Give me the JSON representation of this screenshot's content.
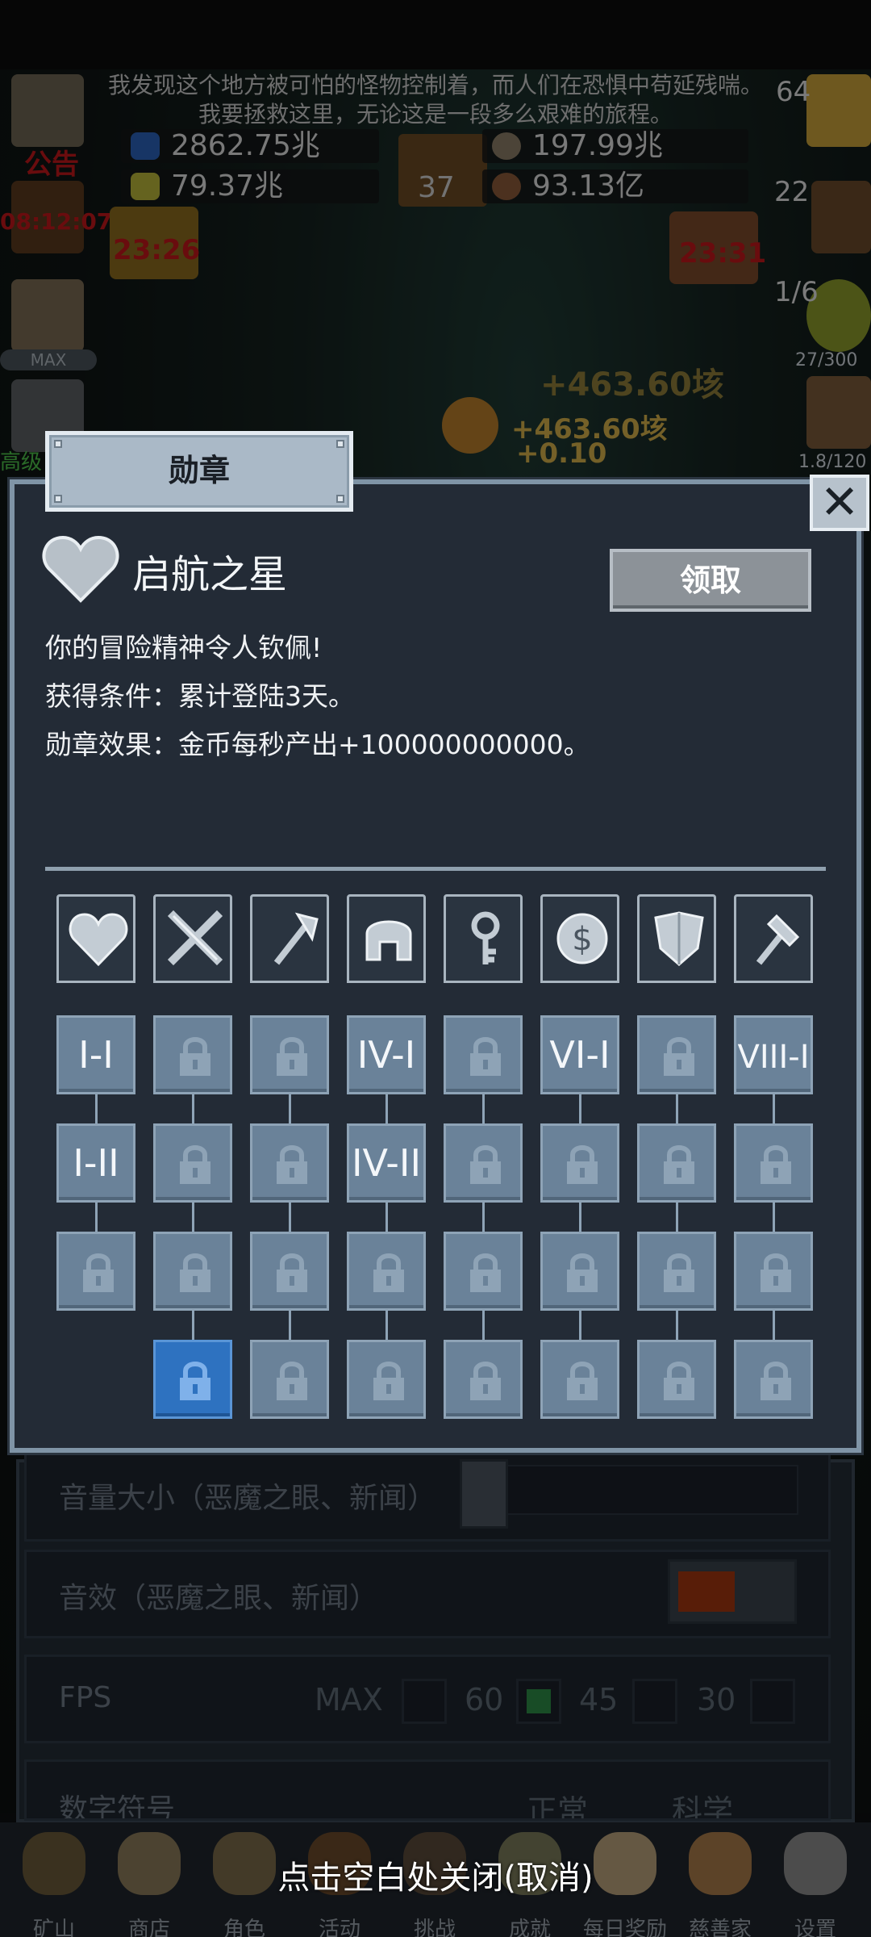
{
  "story": {
    "line1": "我发现这个地方被可怕的怪物控制着，而人们在恐惧中苟延残喘。",
    "line2": "我要拯救这里，无论这是一段多么艰难的旅程。"
  },
  "resources": {
    "blue_potion": "2862.75兆",
    "green_potion": "79.37兆",
    "book_level": "37",
    "stone": "197.99兆",
    "meat": "93.13亿"
  },
  "side": {
    "notice_label": "公告",
    "torch_timer": "08:12:07",
    "chest_timer": "23:26",
    "right_timer": "23:31",
    "potion_count": "64",
    "chest_count": "22",
    "slime_count": "1/6",
    "slime_hp": "27/300",
    "sword_ratio": "1.8/120",
    "max_label": "MAX",
    "key_label": "高级",
    "floating_gain_big": "+463.60垓",
    "floating_gain": "+463.60垓",
    "floating_small": "+0.10"
  },
  "settings": {
    "volume_label": "音量大小（恶魔之眼、新闻）",
    "sfx_label": "音效（恶魔之眼、新闻）",
    "fps_label": "FPS",
    "fps_options": [
      "MAX",
      "60",
      "45",
      "30"
    ],
    "fps_selected": "60",
    "number_label": "数字符号",
    "number_options": [
      "正常",
      "科学"
    ]
  },
  "nav": {
    "items": [
      "矿山",
      "商店",
      "角色",
      "活动",
      "挑战",
      "成就",
      "每日奖励",
      "慈善家",
      "设置"
    ],
    "close_hint": "点击空白处关闭(取消)"
  },
  "dialog": {
    "tab_title": "勋章",
    "close_glyph": "✕",
    "medal_name": "启航之星",
    "claim_label": "领取",
    "flavor": "你的冒险精神令人钦佩!",
    "condition": "获得条件：累计登陆3天。",
    "effect": "勋章效果：金币每秒产出+100000000000。",
    "categories": [
      "heart-icon",
      "crossed-swords-icon",
      "axe-icon",
      "helmet-icon",
      "key-icon",
      "coin-icon",
      "shield-icon",
      "hammer-icon"
    ],
    "grid": [
      [
        "I-I",
        "",
        "",
        "IV-I",
        "",
        "VI-I",
        "",
        "VIII-I"
      ],
      [
        "I-II",
        "",
        "",
        "IV-II",
        "",
        "",
        "",
        ""
      ],
      [
        "",
        "",
        "",
        "",
        "",
        "",
        "",
        ""
      ],
      [
        null,
        "",
        "",
        "",
        "",
        "",
        "",
        ""
      ]
    ],
    "selected_cell": "row3-col1"
  },
  "colors": {
    "dialog_bg": "#232b36",
    "cell_unlocked": "#6a8299",
    "cell_selected": "#2e72c0",
    "timer_red": "#c0171b",
    "gain_gold": "#d3b04a"
  }
}
